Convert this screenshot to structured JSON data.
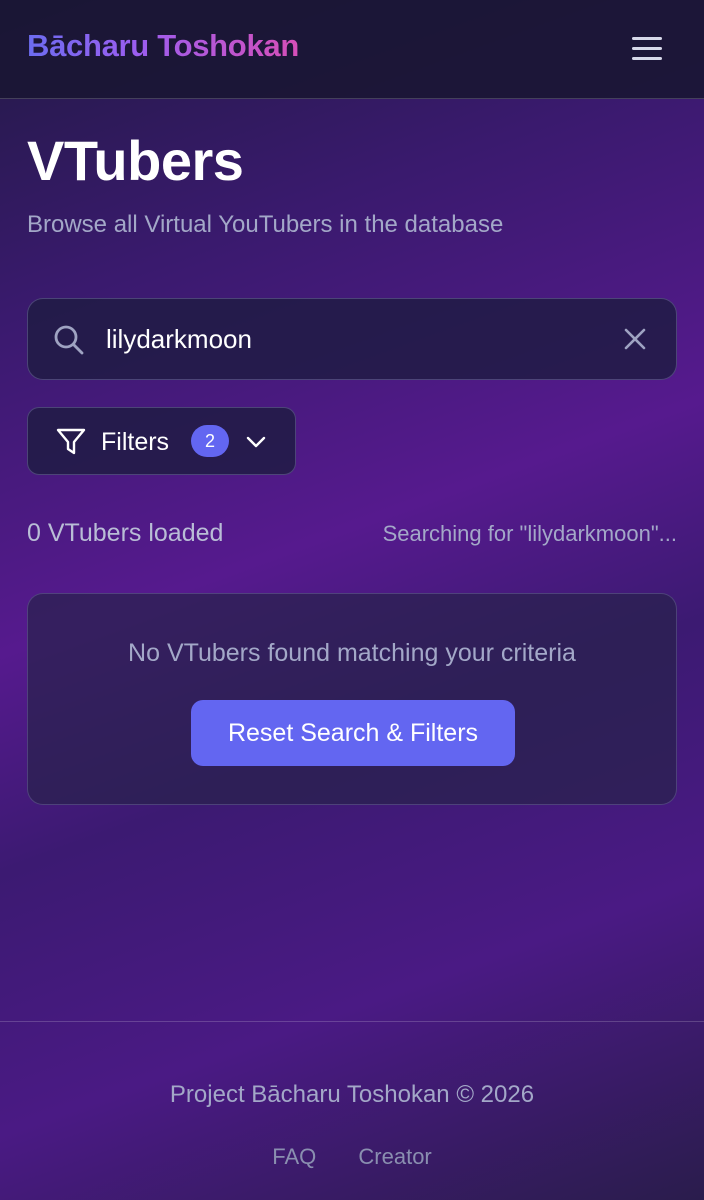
{
  "header": {
    "brand": "Bācharu Toshokan",
    "menu_icon": "hamburger-menu-icon"
  },
  "page": {
    "title": "VTubers",
    "subtitle": "Browse all Virtual YouTubers in the database"
  },
  "search": {
    "icon": "search-icon",
    "value": "lilydarkmoon",
    "clear_icon": "close-icon"
  },
  "filters": {
    "label": "Filters",
    "active_count": "2",
    "icon": "filter-funnel-icon",
    "chevron": "chevron-down-icon"
  },
  "results": {
    "count_text": "0 VTubers loaded",
    "status_text": "Searching for \"lilydarkmoon\"..."
  },
  "empty_state": {
    "message": "No VTubers found matching your criteria",
    "reset_label": "Reset Search & Filters"
  },
  "footer": {
    "copyright": "Project Bācharu Toshokan © 2026",
    "links": [
      "FAQ",
      "Creator"
    ]
  },
  "colors": {
    "accent": "#6366f1",
    "brand_gradient_start": "#6c6cf0",
    "brand_gradient_end": "#d64fb8",
    "muted_text": "#a3a8c8"
  }
}
